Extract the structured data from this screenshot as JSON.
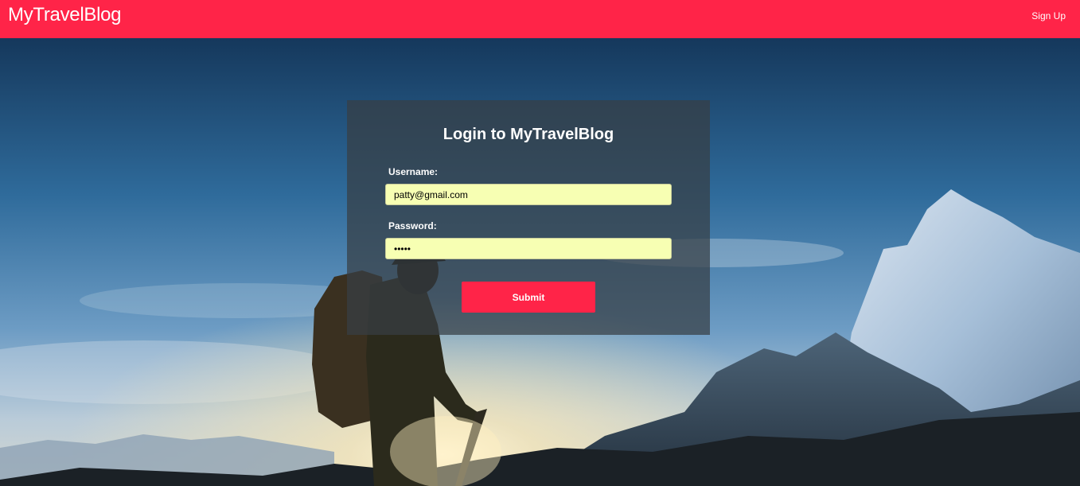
{
  "navbar": {
    "brand": "MyTravelBlog",
    "signup_label": "Sign Up"
  },
  "login": {
    "title": "Login to MyTravelBlog",
    "username_label": "Username:",
    "username_value": "patty@gmail.com",
    "password_label": "Password:",
    "password_value": "patty",
    "submit_label": "Submit"
  },
  "colors": {
    "accent": "#ff2448",
    "input_autofill": "#f7ffb3",
    "panel_overlay": "#373e44"
  },
  "background": {
    "image": "hiker-mountain-photo"
  }
}
